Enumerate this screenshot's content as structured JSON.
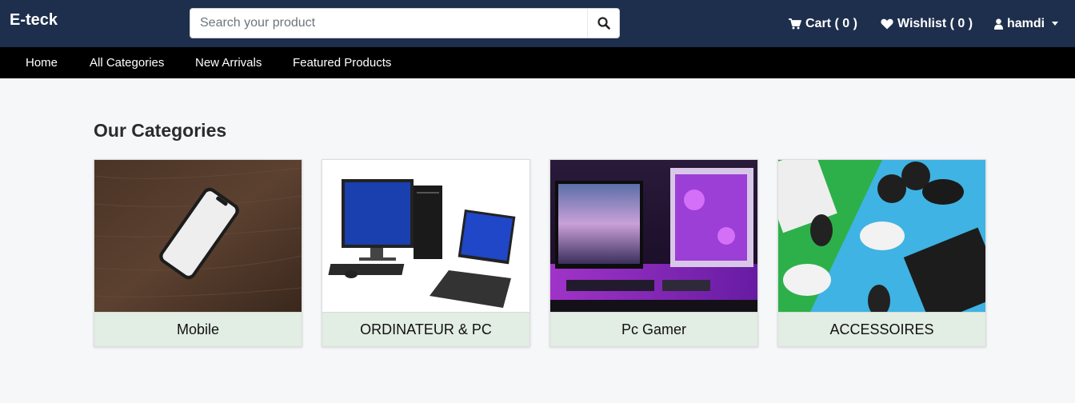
{
  "header": {
    "brand": "E-teck",
    "search": {
      "placeholder": "Search your product",
      "value": ""
    },
    "cart_label": "Cart ( 0 )",
    "wishlist_label": "Wishlist ( 0 )",
    "user_name": "hamdi"
  },
  "nav": {
    "items": [
      "Home",
      "All Categories",
      "New Arrivals",
      "Featured Products"
    ]
  },
  "main": {
    "section_title": "Our Categories",
    "categories": [
      {
        "label": "Mobile"
      },
      {
        "label": "ORDINATEUR & PC"
      },
      {
        "label": "Pc Gamer"
      },
      {
        "label": "ACCESSOIRES"
      }
    ]
  },
  "icons": {
    "search": "search-icon",
    "cart": "shopping-cart-icon",
    "wishlist": "heart-icon",
    "user": "user-icon",
    "user_menu": "caret-down-icon"
  },
  "colors": {
    "header_bg": "#1e2f4d",
    "nav_bg": "#000000",
    "page_bg": "#f5f7f9",
    "card_label_bg": "#e2ede4"
  }
}
